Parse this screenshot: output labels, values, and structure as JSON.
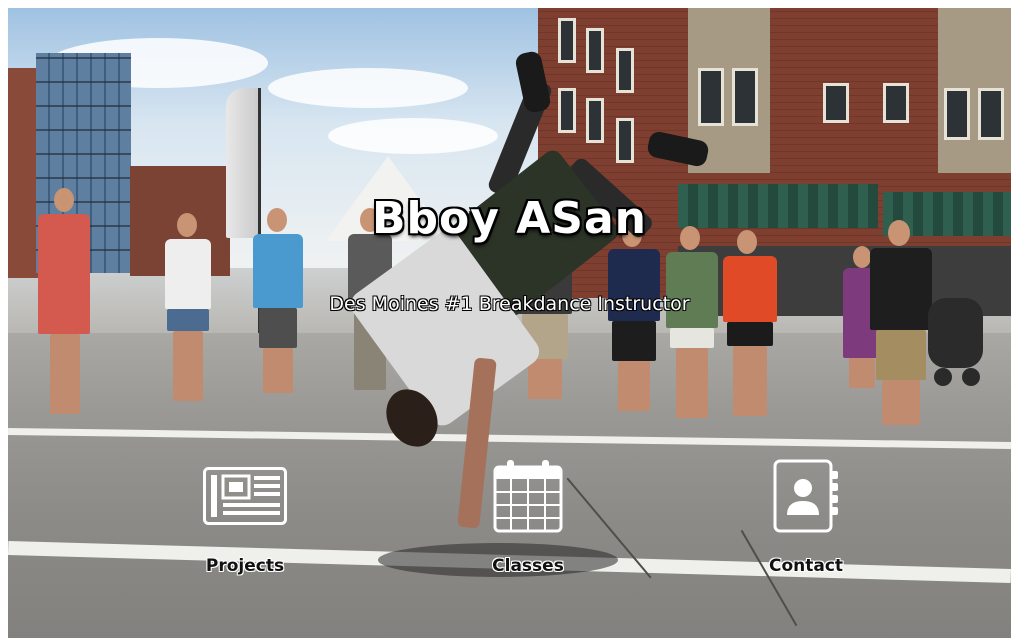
{
  "hero": {
    "title": "Bboy ASan",
    "subtitle": "Des Moines #1 Breakdance Instructor"
  },
  "nav": [
    {
      "label": "Projects",
      "icon": "newspaper-icon"
    },
    {
      "label": "Classes",
      "icon": "calendar-icon"
    },
    {
      "label": "Contact",
      "icon": "address-book-icon"
    }
  ],
  "colors": {
    "title_text": "#ffffff",
    "title_outline": "#000000",
    "nav_label": "#111111",
    "icon_fill": "#ffffff"
  }
}
